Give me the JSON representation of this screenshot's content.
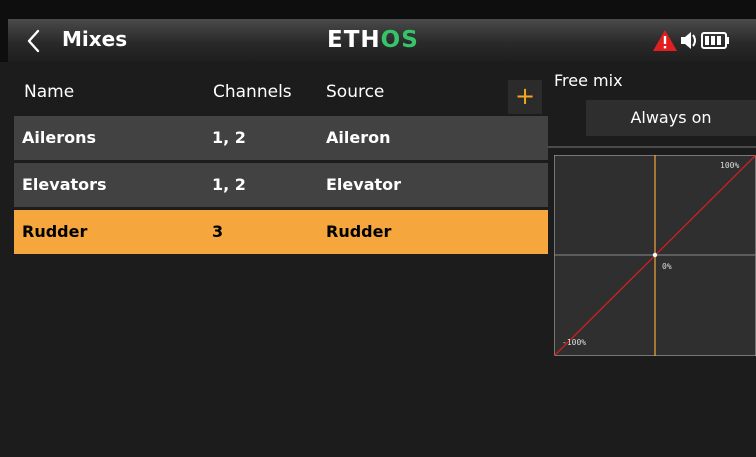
{
  "header": {
    "back_title": "Mixes",
    "brand_left": "ETH",
    "brand_right": "OS",
    "brand_colors": {
      "text": "#ffffff",
      "accent": "#36c36a"
    },
    "status_icons": [
      "warning-icon",
      "speaker-icon",
      "battery-icon"
    ]
  },
  "table": {
    "columns": [
      "Name",
      "Channels",
      "Source"
    ],
    "add_label": "+",
    "rows": [
      {
        "name": "Ailerons",
        "channels": "1, 2",
        "source": "Aileron",
        "selected": false
      },
      {
        "name": "Elevators",
        "channels": "1, 2",
        "source": "Elevator",
        "selected": false
      },
      {
        "name": "Rudder",
        "channels": "3",
        "source": "Rudder",
        "selected": true
      }
    ]
  },
  "detail": {
    "mix_type": "Free mix",
    "active_condition": "Always on",
    "graph": {
      "label_top": "100%",
      "label_center": "0%",
      "label_bottom": "-100%"
    }
  },
  "colors": {
    "accent": "#f5a63c",
    "row_bg": "#424242",
    "curve": "#d02020",
    "warning": "#e02020"
  }
}
